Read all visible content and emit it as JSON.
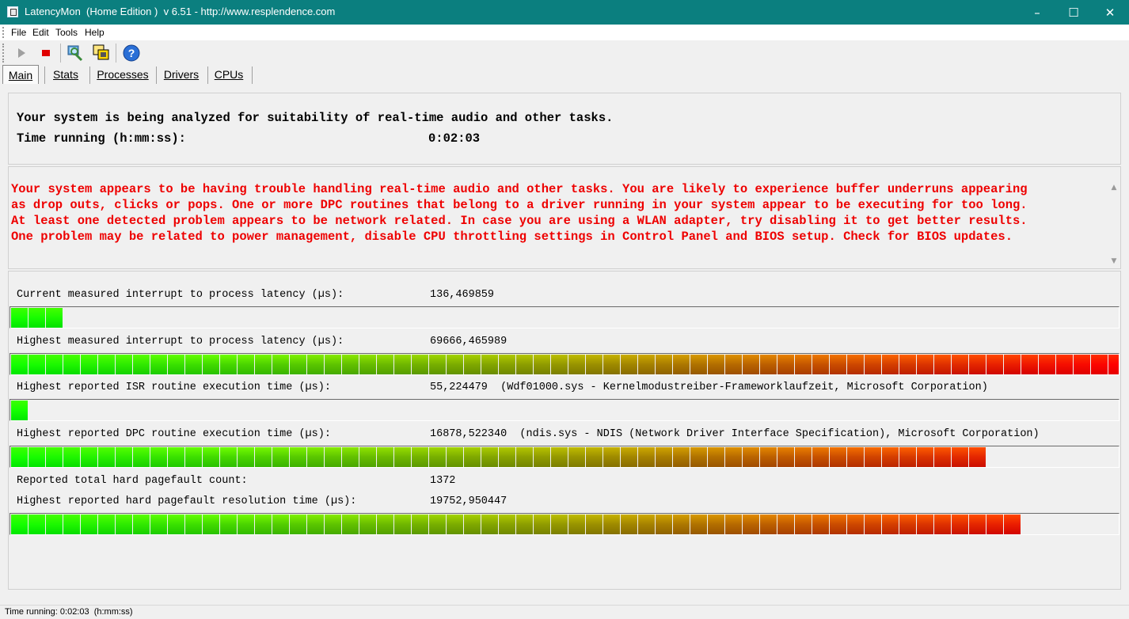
{
  "window": {
    "title": "LatencyMon  (Home Edition )  v 6.51 - http://www.resplendence.com",
    "minimize": "–",
    "maximize": "☐",
    "close": "✕"
  },
  "menu": [
    "File",
    "Edit",
    "Tools",
    "Help"
  ],
  "toolbar": {
    "icons": [
      "play-icon",
      "stop-icon",
      "analyze-icon",
      "windows-icon",
      "help-icon"
    ],
    "help_glyph": "?"
  },
  "tabs": [
    "Main",
    "Stats",
    "Processes",
    "Drivers",
    "CPUs"
  ],
  "header": {
    "line1": "Your system is being analyzed for suitability of real-time audio and other tasks.",
    "time_label": "Time running (h:mm:ss):",
    "time_value": "0:02:03"
  },
  "warning": {
    "line1": "Your system appears to be having trouble handling real-time audio and other tasks. You are likely to experience buffer underruns appearing",
    "line2": "as drop outs, clicks or pops. One or more DPC routines that belong to a driver running in your system appear to be executing for too long.",
    "line3": "At least one detected problem appears to be network related. In case you are using a WLAN adapter, try disabling it to get better results.",
    "line4": "One problem may be related to power management, disable CPU throttling settings in Control Panel and BIOS setup. Check for BIOS updates."
  },
  "metrics": {
    "current_latency": {
      "label": "Current measured interrupt to process latency (µs):",
      "value": "136,469859",
      "bar_fraction": 0.044
    },
    "highest_latency": {
      "label": "Highest measured interrupt to process latency (µs):",
      "value": "69666,465989",
      "bar_fraction": 1.0
    },
    "isr": {
      "label": "Highest reported ISR routine execution time (µs):",
      "value": "55,224479",
      "detail": "(Wdf01000.sys - Kernelmodustreiber-Frameworklaufzeit, Microsoft Corporation)",
      "bar_fraction": 0.015
    },
    "dpc": {
      "label": "Highest reported DPC routine execution time (µs):",
      "value": "16878,522340",
      "detail": "(ndis.sys - NDIS (Network Driver Interface Specification), Microsoft Corporation)",
      "bar_fraction": 0.877
    },
    "pagefault_count": {
      "label": "Reported total hard pagefault count:",
      "value": "1372"
    },
    "pagefault_time": {
      "label": "Highest reported hard pagefault resolution time (µs):",
      "value": "19752,950447",
      "bar_fraction": 0.909
    }
  },
  "status": {
    "text": "Time running: 0:02:03  (h:mm:ss)"
  },
  "colors": {
    "titlebar": "#0b7f7f",
    "warning": "#ee0000",
    "bar_start": "#00ff00",
    "bar_end": "#ff0000"
  }
}
